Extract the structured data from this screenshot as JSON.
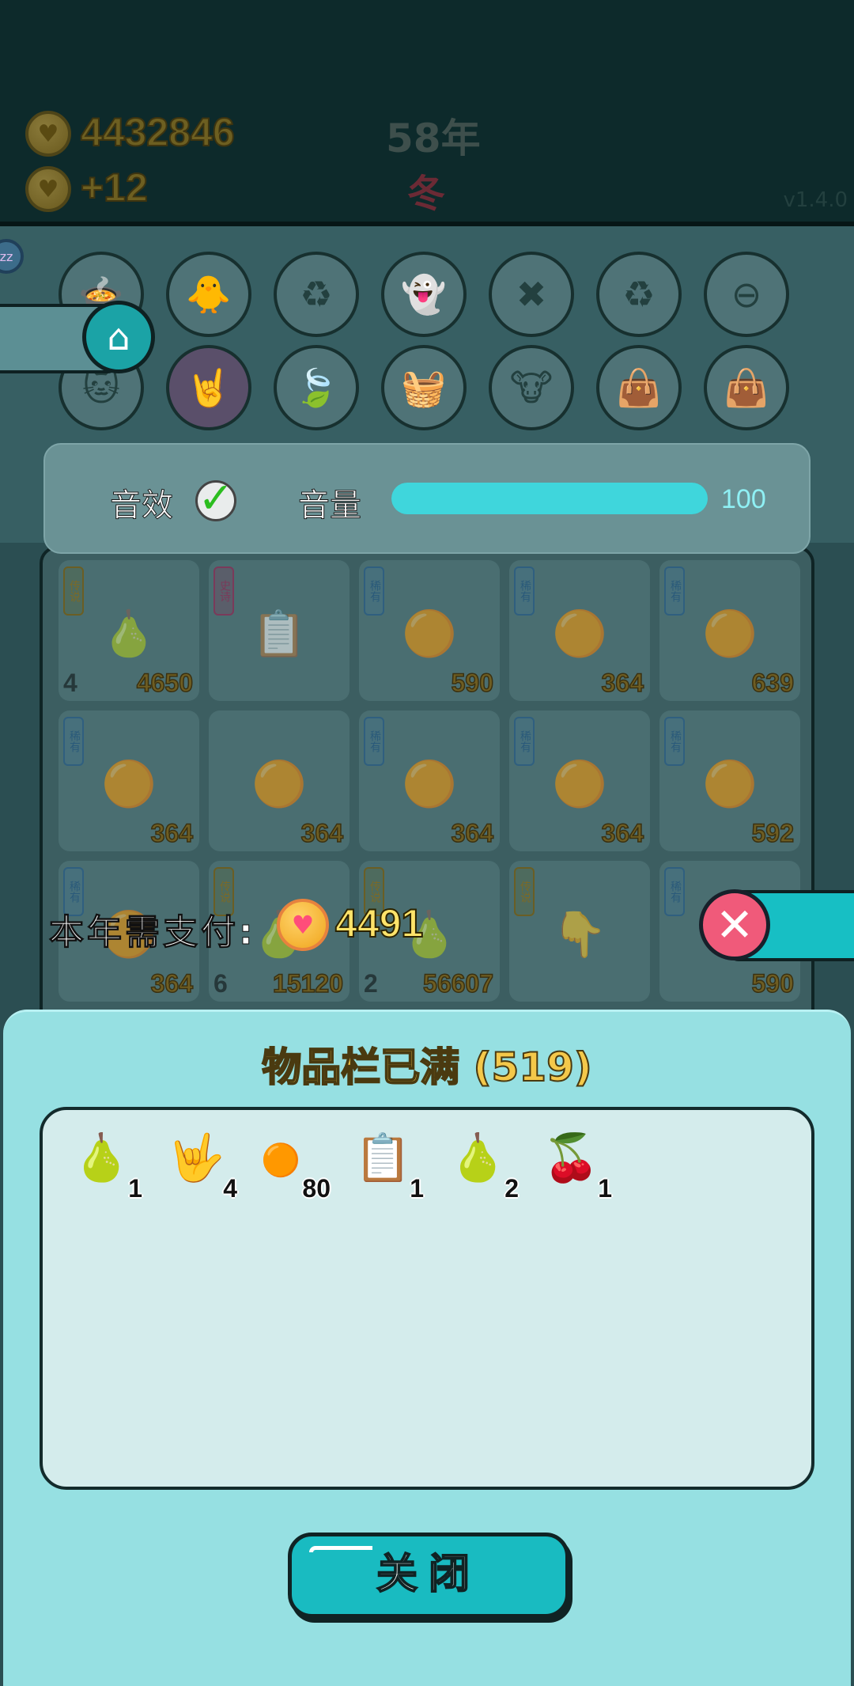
{
  "hud": {
    "coins": "4432846",
    "income": "+12",
    "year": "58年",
    "season": "冬",
    "version": "v1.4.0"
  },
  "settings": {
    "sound_label": "音效",
    "sound_enabled": true,
    "volume_label": "音量",
    "volume_value": "100",
    "volume_fraction": 1.0
  },
  "board": {
    "tiles": [
      {
        "tag": "传说",
        "count": "4",
        "value": "4650",
        "icon": "🍐"
      },
      {
        "tag": "史诗",
        "count": "",
        "value": "",
        "icon": "📋"
      },
      {
        "tag": "稀有",
        "count": "",
        "value": "590",
        "icon": "🟠"
      },
      {
        "tag": "稀有",
        "count": "",
        "value": "364",
        "icon": "🟠"
      },
      {
        "tag": "稀有",
        "count": "",
        "value": "639",
        "icon": "🟠"
      },
      {
        "tag": "稀有",
        "count": "",
        "value": "364",
        "icon": "🟠"
      },
      {
        "tag": "",
        "count": "",
        "value": "364",
        "icon": "🟠"
      },
      {
        "tag": "稀有",
        "count": "",
        "value": "364",
        "icon": "🟠"
      },
      {
        "tag": "稀有",
        "count": "",
        "value": "364",
        "icon": "🟠"
      },
      {
        "tag": "稀有",
        "count": "",
        "value": "592",
        "icon": "🟠"
      },
      {
        "tag": "稀有",
        "count": "",
        "value": "364",
        "icon": "🟠"
      },
      {
        "tag": "传说",
        "count": "6",
        "value": "15120",
        "icon": "🍐"
      },
      {
        "tag": "传说",
        "count": "2",
        "value": "56607",
        "icon": "🍐"
      },
      {
        "tag": "传说",
        "count": "",
        "value": "",
        "icon": "👇"
      },
      {
        "tag": "稀有",
        "count": "",
        "value": "590",
        "icon": "🟠"
      }
    ]
  },
  "pay": {
    "label": "本年需支付:",
    "amount": "4491"
  },
  "inventory": {
    "title": "物品栏已满 (519)",
    "items": [
      {
        "icon": "🍐",
        "qty": "1"
      },
      {
        "icon": "🤟",
        "qty": "4"
      },
      {
        "icon": "🟠",
        "qty": "80"
      },
      {
        "icon": "📋",
        "qty": "1"
      },
      {
        "icon": "🍐",
        "qty": "2"
      },
      {
        "icon": "🍒",
        "qty": "1"
      }
    ],
    "close_label": "关闭"
  },
  "colors": {
    "accent": "#19bbc1",
    "dialog_bg": "#96e0e2",
    "title_gold": "#f4c84a"
  }
}
